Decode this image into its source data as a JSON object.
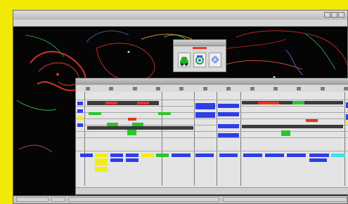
{
  "window": {
    "title": "",
    "menu": [
      "",
      "",
      "",
      "",
      "",
      "",
      ""
    ]
  },
  "report": {
    "toolbar": [
      "",
      "",
      "",
      "",
      "",
      "",
      "",
      "",
      "",
      "",
      "",
      ""
    ],
    "center_header": "",
    "footer": ""
  },
  "status": {
    "fields": [
      "",
      "",
      "",
      ""
    ]
  },
  "colors": {
    "frame_yellow": "#f2ea06",
    "map_background": "#050505",
    "accent_blue": "#2e3de6",
    "accent_red": "#e5351f",
    "accent_green": "#28c72a"
  },
  "icons": [
    "minimize-icon",
    "maximize-icon",
    "close-icon",
    "green-vehicle-icon",
    "target-icon",
    "grid-icon"
  ]
}
